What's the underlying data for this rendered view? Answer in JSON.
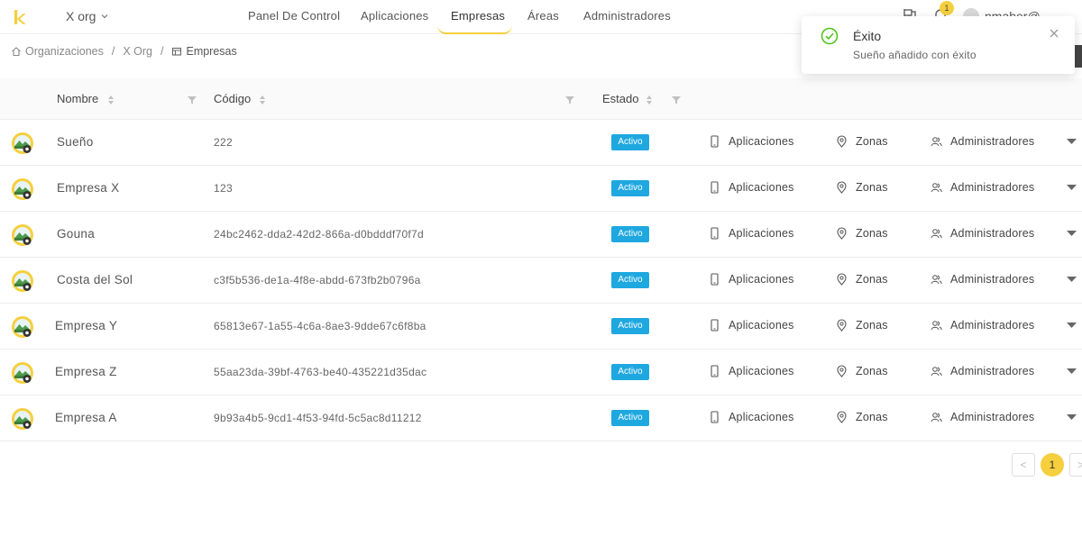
{
  "colors": {
    "accent": "#f5cf3d",
    "status": "#1fa8e0",
    "success": "#52c41a"
  },
  "header": {
    "org": "X org",
    "tabs": [
      {
        "label": "Panel De Control"
      },
      {
        "label": "Aplicaciones"
      },
      {
        "label": "Empresas",
        "active": true
      },
      {
        "label": "Áreas"
      },
      {
        "label": "Administradores"
      }
    ],
    "notification_count": "1",
    "username": "nmaher@"
  },
  "breadcrumb": {
    "items": [
      "Organizaciones",
      "X Org",
      "Empresas"
    ],
    "separator": "/"
  },
  "table": {
    "columns": {
      "name": "Nombre",
      "code": "Código",
      "status": "Estado"
    },
    "action_labels": {
      "apps": "Aplicaciones",
      "zones": "Zonas",
      "admins": "Administradores"
    },
    "rows": [
      {
        "name": "Sueño",
        "code": "222",
        "status": "Activo"
      },
      {
        "name": "Empresa X",
        "code": "123",
        "status": "Activo"
      },
      {
        "name": "Gouna",
        "code": "24bc2462-dda2-42d2-866a-d0bdddf70f7d",
        "status": "Activo"
      },
      {
        "name": "Costa del Sol",
        "code": "c3f5b536-de1a-4f8e-abdd-673fb2b0796a",
        "status": "Activo"
      },
      {
        "name": "Empresa Y",
        "code": "65813e67-1a55-4c6a-8ae3-9dde67c6f8ba",
        "status": "Activo"
      },
      {
        "name": "Empresa Z",
        "code": "55aa23da-39bf-4763-be40-435221d35dac",
        "status": "Activo"
      },
      {
        "name": "Empresa A",
        "code": "9b93a4b5-9cd1-4f53-94fd-5c5ac8d11212",
        "status": "Activo"
      }
    ]
  },
  "pagination": {
    "current": "1",
    "prev": "<",
    "next": ">"
  },
  "toast": {
    "title": "Éxito",
    "message": "Sueño añadido con éxito",
    "icon": "check-circle-icon"
  }
}
